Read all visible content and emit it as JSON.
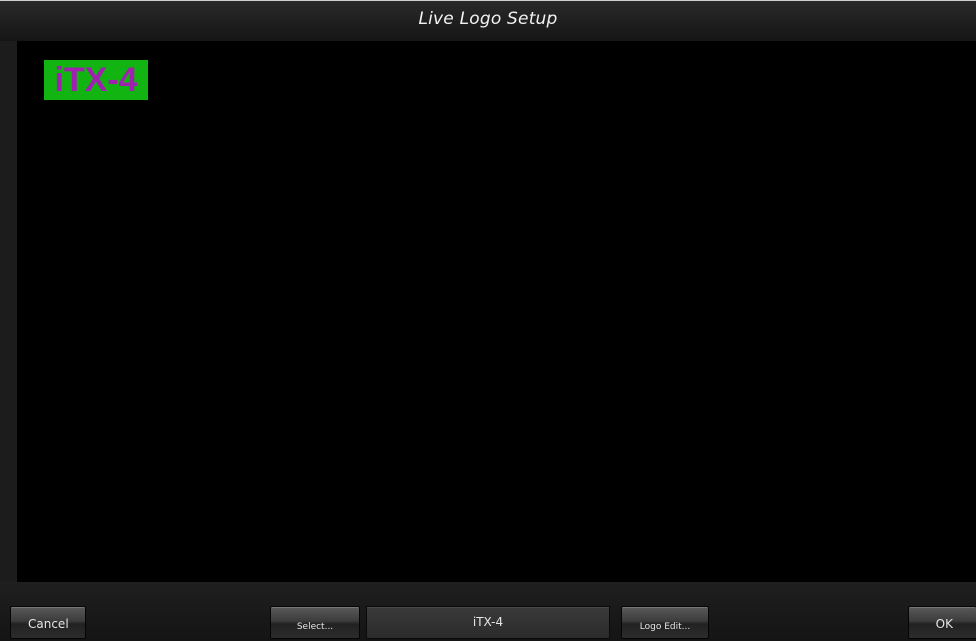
{
  "window": {
    "title": "Live Logo Setup"
  },
  "preview": {
    "logo_text": "iTX-4",
    "logo_text_color": "#a020b0",
    "logo_background_color": "#11b411"
  },
  "footer": {
    "cancel_label": "Cancel",
    "select_label": "Select...",
    "current_logo": "iTX-4",
    "logo_edit_label": "Logo Edit...",
    "ok_label": "OK"
  }
}
